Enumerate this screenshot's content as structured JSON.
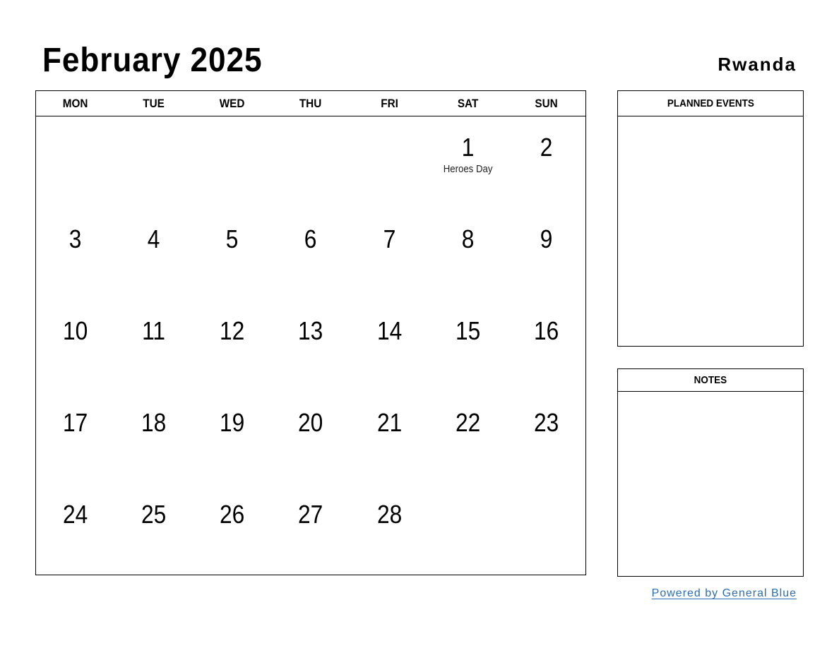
{
  "header": {
    "title": "February 2025",
    "country": "Rwanda"
  },
  "calendar": {
    "weekdays": [
      "MON",
      "TUE",
      "WED",
      "THU",
      "FRI",
      "SAT",
      "SUN"
    ],
    "weeks": [
      [
        {
          "day": "",
          "holiday": ""
        },
        {
          "day": "",
          "holiday": ""
        },
        {
          "day": "",
          "holiday": ""
        },
        {
          "day": "",
          "holiday": ""
        },
        {
          "day": "",
          "holiday": ""
        },
        {
          "day": "1",
          "holiday": "Heroes Day"
        },
        {
          "day": "2",
          "holiday": ""
        }
      ],
      [
        {
          "day": "3",
          "holiday": ""
        },
        {
          "day": "4",
          "holiday": ""
        },
        {
          "day": "5",
          "holiday": ""
        },
        {
          "day": "6",
          "holiday": ""
        },
        {
          "day": "7",
          "holiday": ""
        },
        {
          "day": "8",
          "holiday": ""
        },
        {
          "day": "9",
          "holiday": ""
        }
      ],
      [
        {
          "day": "10",
          "holiday": ""
        },
        {
          "day": "11",
          "holiday": ""
        },
        {
          "day": "12",
          "holiday": ""
        },
        {
          "day": "13",
          "holiday": ""
        },
        {
          "day": "14",
          "holiday": ""
        },
        {
          "day": "15",
          "holiday": ""
        },
        {
          "day": "16",
          "holiday": ""
        }
      ],
      [
        {
          "day": "17",
          "holiday": ""
        },
        {
          "day": "18",
          "holiday": ""
        },
        {
          "day": "19",
          "holiday": ""
        },
        {
          "day": "20",
          "holiday": ""
        },
        {
          "day": "21",
          "holiday": ""
        },
        {
          "day": "22",
          "holiday": ""
        },
        {
          "day": "23",
          "holiday": ""
        }
      ],
      [
        {
          "day": "24",
          "holiday": ""
        },
        {
          "day": "25",
          "holiday": ""
        },
        {
          "day": "26",
          "holiday": ""
        },
        {
          "day": "27",
          "holiday": ""
        },
        {
          "day": "28",
          "holiday": ""
        },
        {
          "day": "",
          "holiday": ""
        },
        {
          "day": "",
          "holiday": ""
        }
      ]
    ]
  },
  "sidebar": {
    "planned_events_label": "PLANNED EVENTS",
    "notes_label": "NOTES"
  },
  "footer": {
    "link_text": "Powered by General Blue",
    "link_color": "#2a6ebb"
  }
}
